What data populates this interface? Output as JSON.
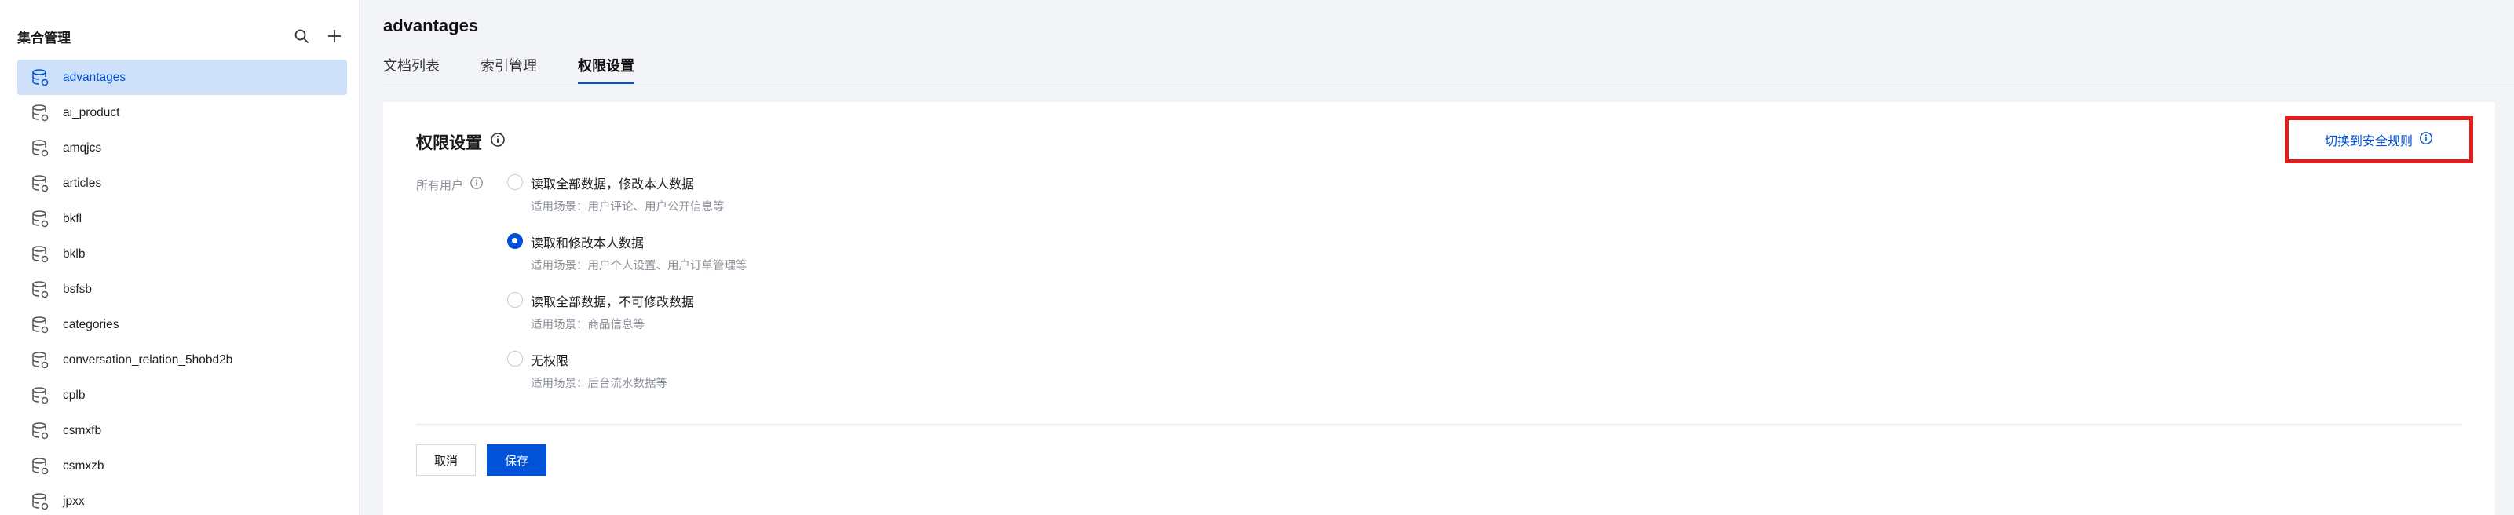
{
  "sidebar": {
    "title": "集合管理",
    "icons": {
      "search": "search-icon",
      "add": "plus-icon"
    },
    "collections": [
      {
        "label": "advantages",
        "active": true
      },
      {
        "label": "ai_product"
      },
      {
        "label": "amqjcs"
      },
      {
        "label": "articles"
      },
      {
        "label": "bkfl"
      },
      {
        "label": "bklb"
      },
      {
        "label": "bsfsb"
      },
      {
        "label": "categories"
      },
      {
        "label": "conversation_relation_5hobd2b"
      },
      {
        "label": "cplb"
      },
      {
        "label": "csmxfb"
      },
      {
        "label": "csmxzb"
      },
      {
        "label": "jpxx"
      }
    ]
  },
  "main": {
    "title": "advantages",
    "tabs": [
      {
        "label": "文档列表"
      },
      {
        "label": "索引管理"
      },
      {
        "label": "权限设置",
        "active": true
      }
    ],
    "permission": {
      "title": "权限设置",
      "switch_label": "切换到安全规则",
      "field_label": "所有用户",
      "options": [
        {
          "title": "读取全部数据，修改本人数据",
          "desc": "适用场景：用户评论、用户公开信息等"
        },
        {
          "title": "读取和修改本人数据",
          "desc": "适用场景：用户个人设置、用户订单管理等",
          "checked": true
        },
        {
          "title": "读取全部数据，不可修改数据",
          "desc": "适用场景：商品信息等"
        },
        {
          "title": "无权限",
          "desc": "适用场景：后台流水数据等"
        }
      ],
      "cancel_label": "取消",
      "save_label": "保存"
    }
  },
  "colors": {
    "accent": "#0052d9",
    "highlight_border": "#e01e1e",
    "active_item_bg": "#cfe0fb"
  }
}
